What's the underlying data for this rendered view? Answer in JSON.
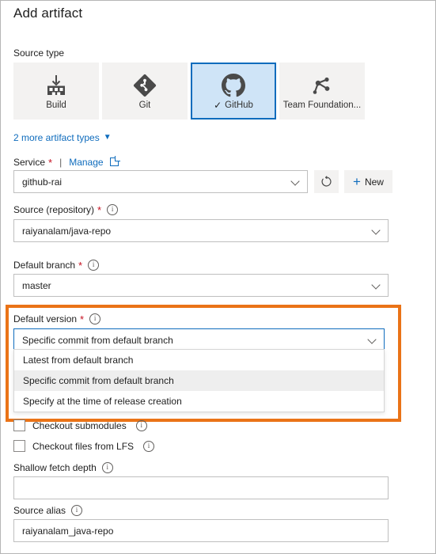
{
  "panel": {
    "title": "Add artifact"
  },
  "source_type": {
    "label": "Source type",
    "tiles": [
      {
        "label": "Build",
        "icon": "build-icon",
        "selected": false
      },
      {
        "label": "Git",
        "icon": "git-icon",
        "selected": false
      },
      {
        "label": "GitHub",
        "icon": "github-icon",
        "selected": true
      },
      {
        "label": "Team Foundation...",
        "icon": "team-foundation-icon",
        "selected": false
      }
    ],
    "more_link": "2 more artifact types",
    "more_chevron": "chevron-down-icon"
  },
  "service": {
    "label": "Service",
    "required_marker": "*",
    "separator": "|",
    "manage_link": "Manage",
    "external_icon": "external-link-icon",
    "value": "github-rai",
    "refresh_icon": "refresh-icon",
    "new_label": "New",
    "plus_icon": "plus-icon"
  },
  "source_repository": {
    "label": "Source (repository)",
    "required_marker": "*",
    "info_icon": "info-icon",
    "value": "raiyanalam/java-repo"
  },
  "default_branch": {
    "label": "Default branch",
    "required_marker": "*",
    "info_icon": "info-icon",
    "value": "master"
  },
  "default_version": {
    "label": "Default version",
    "required_marker": "*",
    "info_icon": "info-icon",
    "value": "Specific commit from default branch",
    "options": [
      "Latest from default branch",
      "Specific commit from default branch",
      "Specify at the time of release creation"
    ],
    "selected_option_index": 1,
    "highlight_color": "#ea7317"
  },
  "checkboxes": [
    {
      "label": "Checkout submodules",
      "checked": false,
      "info_icon": "info-icon"
    },
    {
      "label": "Checkout files from LFS",
      "checked": false,
      "info_icon": "info-icon"
    }
  ],
  "shallow_fetch_depth": {
    "label": "Shallow fetch depth",
    "info_icon": "info-icon",
    "value": "",
    "placeholder": ""
  },
  "source_alias": {
    "label": "Source alias",
    "info_icon": "info-icon",
    "value": "raiyanalam_java-repo"
  },
  "colors": {
    "accent": "#0f6cbd",
    "required": "#c50f1f",
    "highlight": "#ea7317",
    "tile_bg": "#f3f2f1",
    "tile_selected_bg": "#cfe4f7"
  }
}
